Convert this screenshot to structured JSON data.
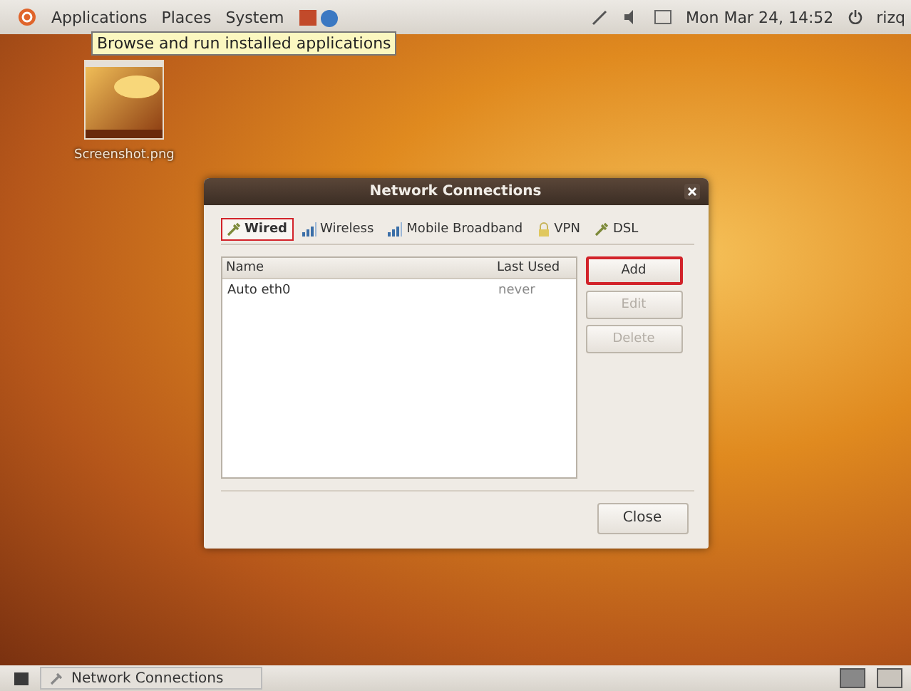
{
  "top_panel": {
    "menus": [
      "Applications",
      "Places",
      "System"
    ],
    "tooltip": "Browse and run installed applications",
    "clock": "Mon Mar 24, 14:52",
    "user": "rizq"
  },
  "desktop_icons": [
    {
      "label": "Screenshot.png"
    }
  ],
  "window": {
    "title": "Network Connections",
    "tabs": [
      {
        "label": "Wired",
        "kind": "wired",
        "selected": true,
        "highlighted": true
      },
      {
        "label": "Wireless",
        "kind": "signal",
        "selected": false,
        "highlighted": false
      },
      {
        "label": "Mobile Broadband",
        "kind": "signal",
        "selected": false,
        "highlighted": false
      },
      {
        "label": "VPN",
        "kind": "lock",
        "selected": false,
        "highlighted": false
      },
      {
        "label": "DSL",
        "kind": "wired",
        "selected": false,
        "highlighted": false
      }
    ],
    "table": {
      "columns": [
        "Name",
        "Last Used"
      ],
      "rows": [
        [
          "Auto eth0",
          "never"
        ]
      ]
    },
    "side_buttons": [
      {
        "label": "Add",
        "disabled": false,
        "highlighted": true
      },
      {
        "label": "Edit",
        "disabled": true,
        "highlighted": false
      },
      {
        "label": "Delete",
        "disabled": true,
        "highlighted": false
      }
    ],
    "close_button": "Close"
  },
  "taskbar": {
    "tasks": [
      "Network Connections"
    ]
  }
}
